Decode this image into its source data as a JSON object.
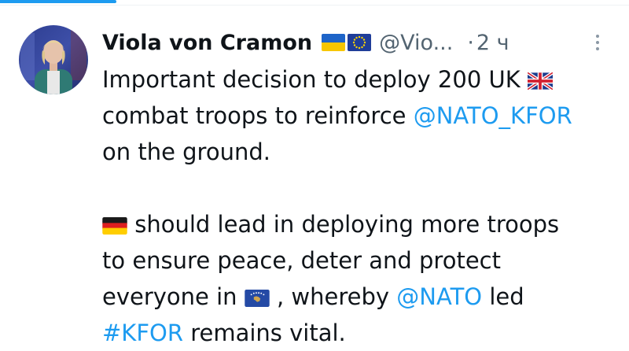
{
  "tweet": {
    "author": {
      "display_name": "Viola von Cramon",
      "handle": "@Vio...",
      "flags": [
        "ukraine-flag",
        "eu-flag"
      ]
    },
    "separator": "·",
    "time": "2 ч",
    "body": {
      "line1": {
        "text": "Important decision to deploy 200 UK",
        "flag": "uk-flag"
      },
      "line2": {
        "text": "combat troops to reinforce",
        "mention": "@NATO_KFOR"
      },
      "line3": {
        "text": "on the ground."
      },
      "line4": {
        "flag": "germany-flag",
        "text": "should lead in deploying more troops"
      },
      "line5": {
        "text": "to ensure peace, deter and protect"
      },
      "line6": {
        "text_before": "everyone in",
        "flag": "kosovo-flag",
        "text_middle": ", whereby",
        "mention": "@NATO",
        "text_after": "led"
      },
      "line7": {
        "hashtag": "#KFOR",
        "text": "remains vital."
      }
    }
  },
  "colors": {
    "link": "#1d9bf0",
    "text": "#0f1419",
    "secondary": "#536471"
  }
}
